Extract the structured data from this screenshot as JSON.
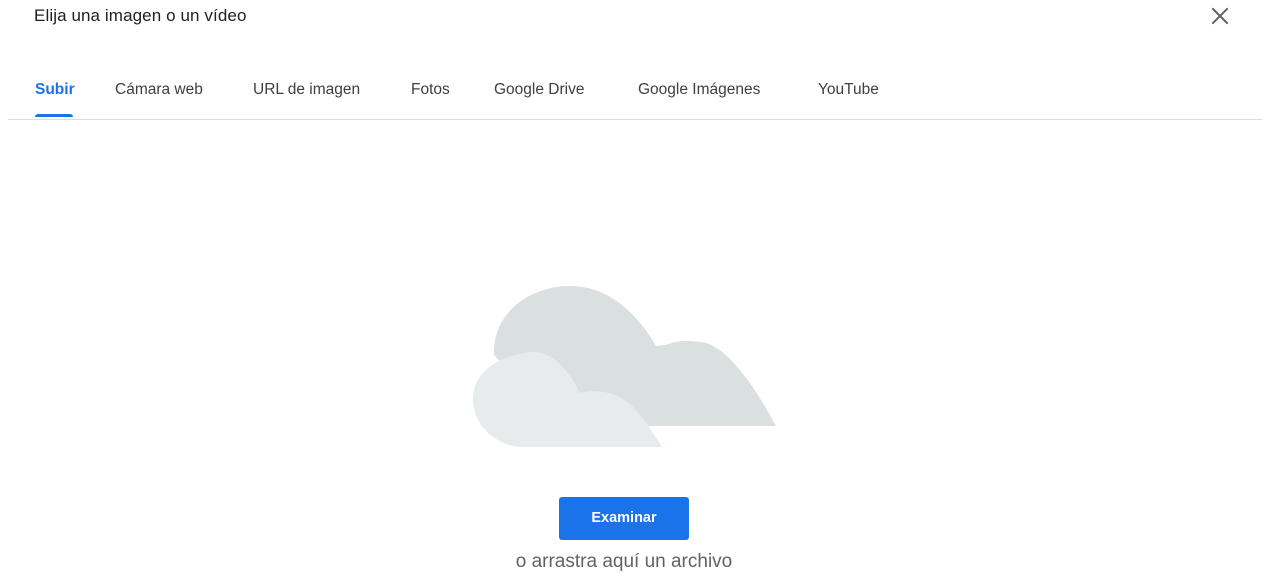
{
  "dialog": {
    "title": "Elija una imagen o un vídeo",
    "close_icon": "close-icon"
  },
  "tabs": [
    {
      "label": "Subir",
      "active": true
    },
    {
      "label": "Cámara web",
      "active": false
    },
    {
      "label": "URL de imagen",
      "active": false
    },
    {
      "label": "Fotos",
      "active": false
    },
    {
      "label": "Google Drive",
      "active": false
    },
    {
      "label": "Google Imágenes",
      "active": false
    },
    {
      "label": "YouTube",
      "active": false
    }
  ],
  "upload": {
    "illustration_icon": "cloud-icon",
    "browse_label": "Examinar",
    "drop_hint": "o arrastra aquí un archivo"
  },
  "colors": {
    "accent": "#1a73e8",
    "cloud_back": "#dadfdf",
    "cloud_front": "#e8ebeb"
  }
}
